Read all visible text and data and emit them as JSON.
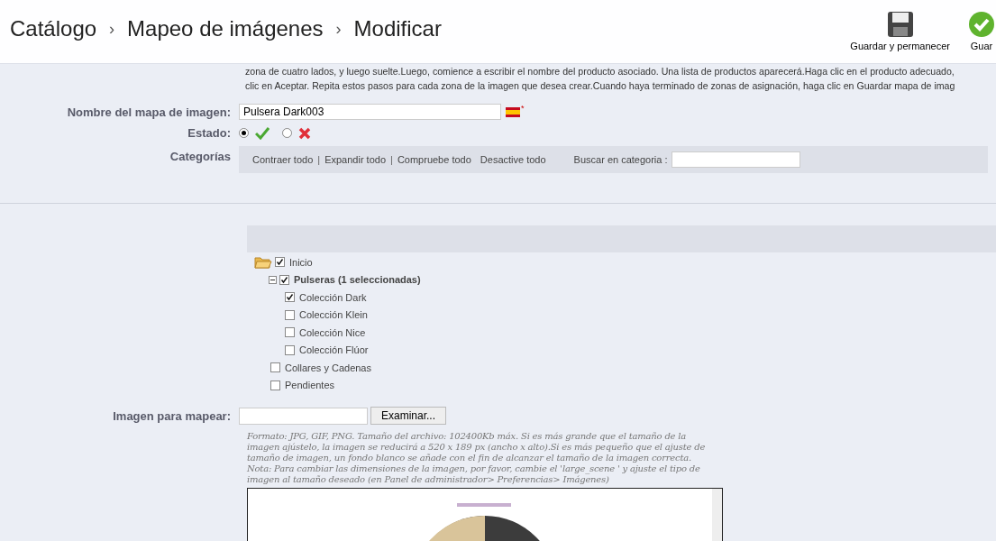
{
  "breadcrumb": [
    "Catálogo",
    "Mapeo de imágenes",
    "Modificar"
  ],
  "breadcrumb_separator": "›",
  "toolbar": [
    {
      "kind": "save",
      "label": "Guardar y permanecer"
    },
    {
      "kind": "ok",
      "label": "Guar"
    }
  ],
  "help_lines": [
    "zona de cuatro lados, y luego suelte.Luego, comience a escribir el nombre del producto asociado. Una lista de productos aparecerá.Haga clic en el producto adecuado,",
    "clic en Aceptar. Repita estos pasos para cada zona de la imagen que desea crear.Cuando haya terminado de zonas de asignación, haga clic en Guardar mapa de imag"
  ],
  "name_field": {
    "label": "Nombre del mapa de imagen:",
    "value": "Pulsera Dark003",
    "required_mark": "*"
  },
  "status": {
    "label": "Estado:",
    "options": [
      {
        "kind": "enabled",
        "selected": true
      },
      {
        "kind": "disabled",
        "selected": false
      }
    ]
  },
  "categories": {
    "label": "Categorías",
    "actions": [
      "Contraer todo",
      "Expandir todo",
      "Compruebe todo",
      "Desactive todo"
    ],
    "action_separators": [
      "|",
      "|"
    ],
    "search_label": "Buscar en categoria :",
    "tree": [
      {
        "label": "Inicio",
        "checked": true,
        "children": [
          {
            "label": "Pulseras (1 seleccionadas)",
            "checked": true,
            "bold": true,
            "children": [
              {
                "label": "Colección Dark",
                "checked": true
              },
              {
                "label": "Colección Klein",
                "checked": false
              },
              {
                "label": "Colección Nice",
                "checked": false
              },
              {
                "label": "Colección Flúor",
                "checked": false
              }
            ]
          },
          {
            "label": "Collares y Cadenas",
            "checked": false
          },
          {
            "label": "Pendientes",
            "checked": false
          }
        ]
      }
    ]
  },
  "image_field": {
    "label": "Imagen para mapear:",
    "button": "Examinar...",
    "hint": "Formato: JPG, GIF, PNG. Tamaño del archivo: 102400Kb máx. Si es más grande que el tamaño de la imagen ajústelo, la imagen se reducirá a 520 x 189 px (ancho x alto).Si es más pequeño que el ajuste de tamaño de imagen, un fondo blanco se añade con el fin de alcanzar el tamaño de la imagen correcta.",
    "note": "Nota: Para cambiar las dimensiones de la imagen, por favor, cambie el 'large_scene ' y ajuste el tipo de imagen al tamaño deseado (en Panel de administrador> Preferencias> Imágenes)"
  }
}
